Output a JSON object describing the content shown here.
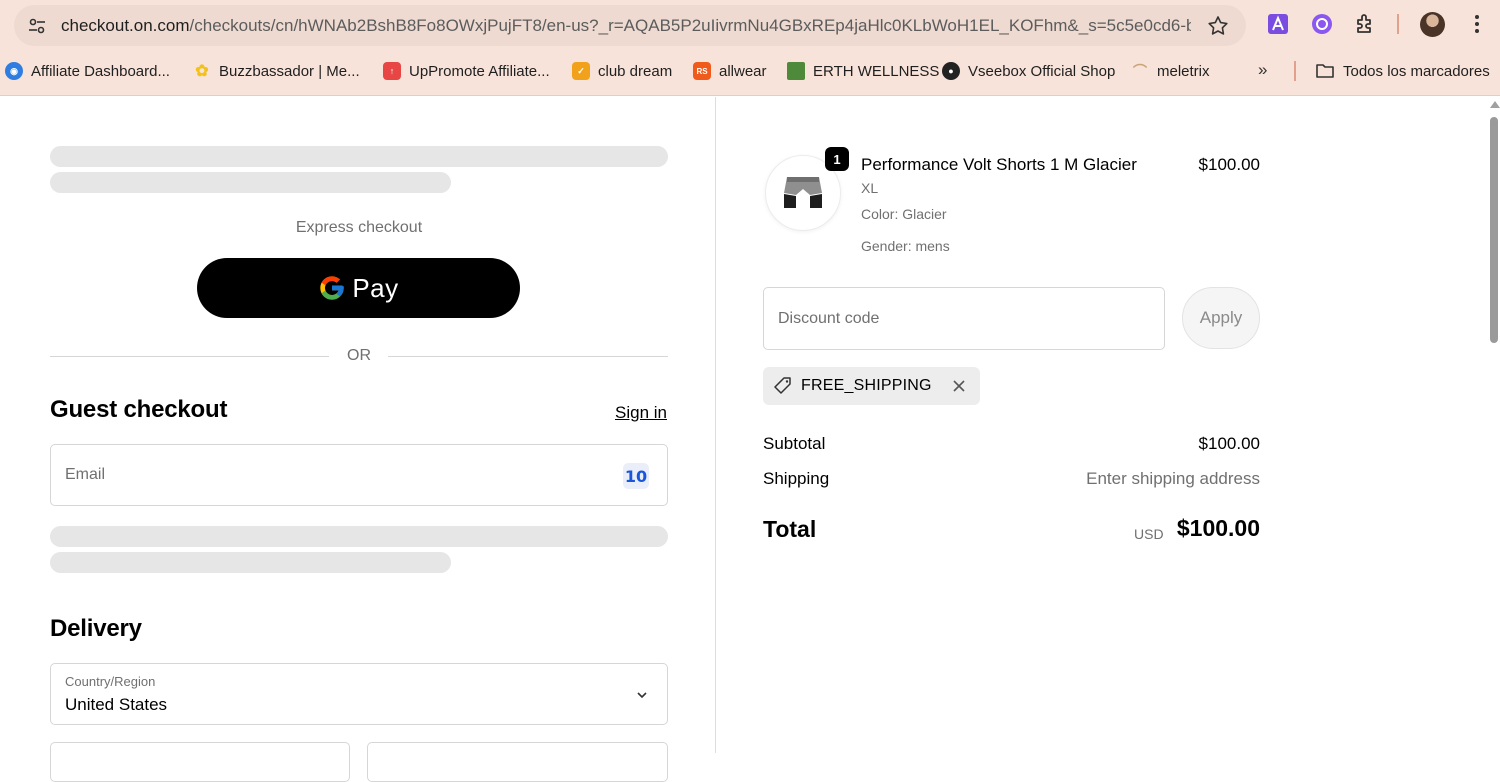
{
  "browser": {
    "url_main": "checkout.on.com",
    "url_rest": "/checkouts/cn/hWNAb2BshB8Fo8OWxjPujFT8/en-us?_r=AQAB5P2uIivrmNu4GBxREp4jaHlc0KLbWoH1EL_KOFhm&_s=5c5e0cd6-b...",
    "bookmarks": [
      {
        "label": "Affiliate Dashboard...",
        "icon": "globe-blue-icon",
        "color": "#2f7de1"
      },
      {
        "label": "Buzzbassador | Me...",
        "icon": "buzz-icon",
        "color": "#f2c21a"
      },
      {
        "label": "UpPromote Affiliate...",
        "icon": "uppromote-icon",
        "color": "#e84545"
      },
      {
        "label": "club dream",
        "icon": "club-dream-icon",
        "color": "#f2a11a"
      },
      {
        "label": "allwear",
        "icon": "allwear-icon",
        "color": "#f05a1a"
      },
      {
        "label": "ERTH WELLNESS",
        "icon": "erth-icon",
        "color": "#4f8a3a"
      },
      {
        "label": "Vseebox Official Shop",
        "icon": "vseebox-icon",
        "color": "#222222"
      },
      {
        "label": "meletrix",
        "icon": "meletrix-icon",
        "color": "#e7c9a3"
      }
    ],
    "bookmarks_more": "»",
    "all_bookmarks": "Todos los marcadores"
  },
  "checkout": {
    "express_label": "Express checkout",
    "gpay_label": "Pay",
    "or_label": "OR",
    "guest_heading": "Guest checkout",
    "sign_in": "Sign in",
    "email_placeholder": "Email",
    "delivery_heading": "Delivery",
    "country_label": "Country/Region",
    "country_value": "United States"
  },
  "summary": {
    "qty": "1",
    "product_name": "Performance Volt Shorts 1 M Glacier",
    "product_price": "$100.00",
    "size": "XL",
    "color": "Color: Glacier",
    "gender": "Gender: mens",
    "discount_placeholder": "Discount code",
    "apply_label": "Apply",
    "discount_tag": "FREE_SHIPPING",
    "subtotal_label": "Subtotal",
    "subtotal_value": "$100.00",
    "shipping_label": "Shipping",
    "shipping_value": "Enter shipping address",
    "total_label": "Total",
    "currency": "USD",
    "total_value": "$100.00"
  }
}
